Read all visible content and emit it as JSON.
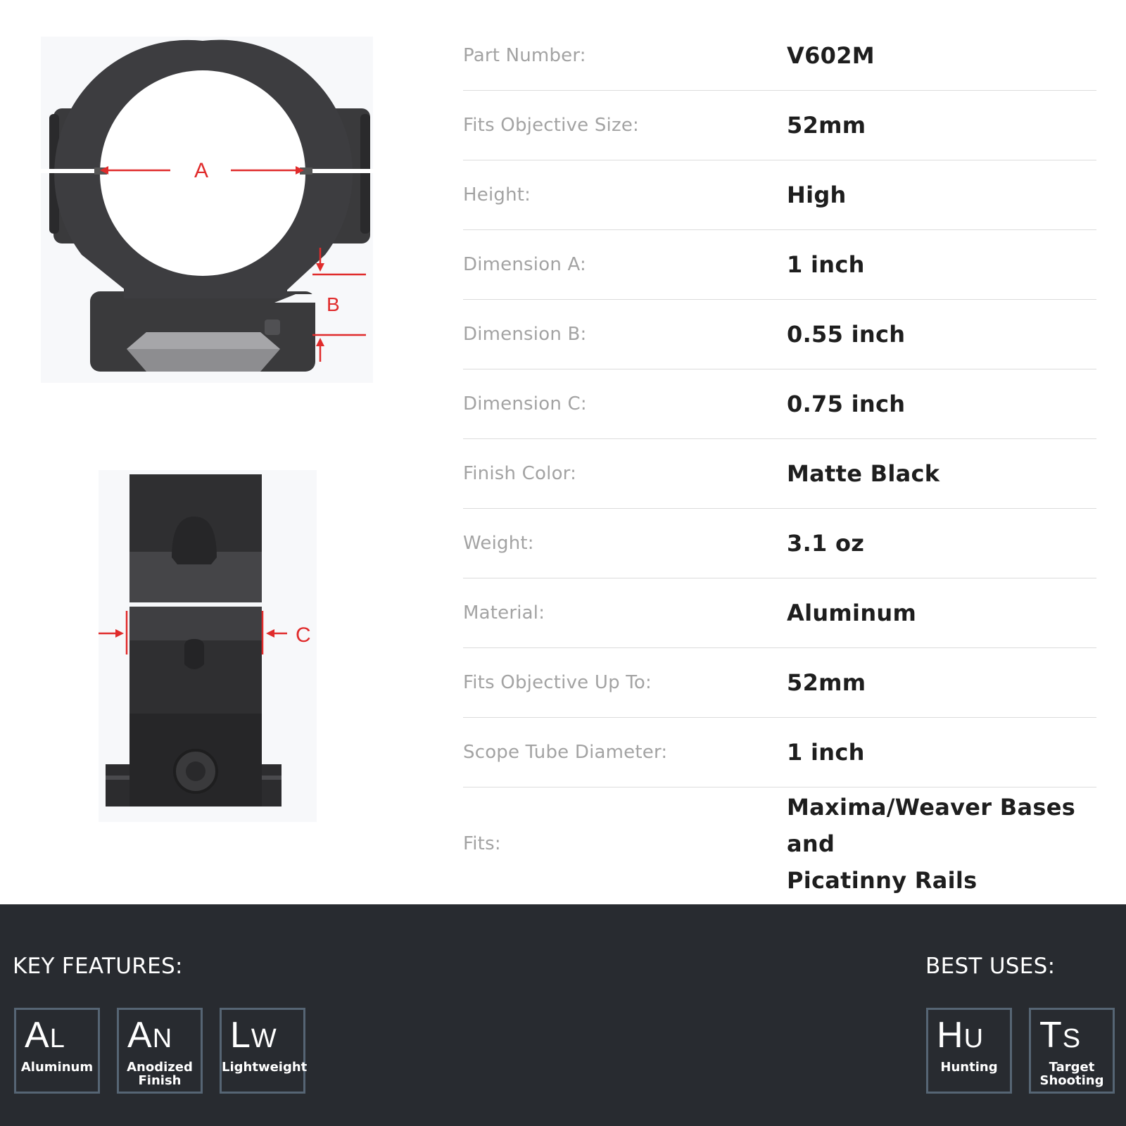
{
  "diagrams": {
    "front": {
      "label_a": "A",
      "label_b": "B"
    },
    "side": {
      "label_c": "C"
    }
  },
  "specs": [
    {
      "label": "Part Number:",
      "value": "V602M"
    },
    {
      "label": "Fits Objective Size:",
      "value": "52mm"
    },
    {
      "label": "Height:",
      "value": "High"
    },
    {
      "label": "Dimension A:",
      "value": "1 inch"
    },
    {
      "label": "Dimension B:",
      "value": "0.55 inch"
    },
    {
      "label": "Dimension C:",
      "value": "0.75 inch"
    },
    {
      "label": "Finish Color:",
      "value": "Matte Black"
    },
    {
      "label": "Weight:",
      "value": "3.1 oz"
    },
    {
      "label": "Material:",
      "value": "Aluminum"
    },
    {
      "label": "Fits Objective Up To:",
      "value": "52mm"
    },
    {
      "label": "Scope Tube Diameter:",
      "value": "1 inch"
    },
    {
      "label": "Fits:",
      "value_line1": "Maxima/Weaver Bases and",
      "value_line2": "Picatinny Rails"
    }
  ],
  "key_features": {
    "title": "KEY FEATURES:",
    "items": [
      {
        "sym_big": "A",
        "sym_small": "L",
        "name": "Aluminum",
        "icon": "aluminum-icon"
      },
      {
        "sym_big": "A",
        "sym_small": "N",
        "name_line1": "Anodized",
        "name_line2": "Finish",
        "icon": "anodized-finish-icon"
      },
      {
        "sym_big": "L",
        "sym_small": "W",
        "name": "Lightweight",
        "icon": "lightweight-icon"
      }
    ]
  },
  "best_uses": {
    "title": "BEST USES:",
    "items": [
      {
        "sym_big": "H",
        "sym_small": "U",
        "name": "Hunting",
        "icon": "hunting-icon"
      },
      {
        "sym_big": "T",
        "sym_small": "S",
        "name_line1": "Target",
        "name_line2": "Shooting",
        "icon": "target-shooting-icon"
      }
    ]
  },
  "colors": {
    "panel_bg": "#282b30",
    "tile_border": "#566574",
    "dimension_red": "#e02b2b",
    "label_gray": "#a3a3a3",
    "value_dark": "#1e1e1e"
  }
}
